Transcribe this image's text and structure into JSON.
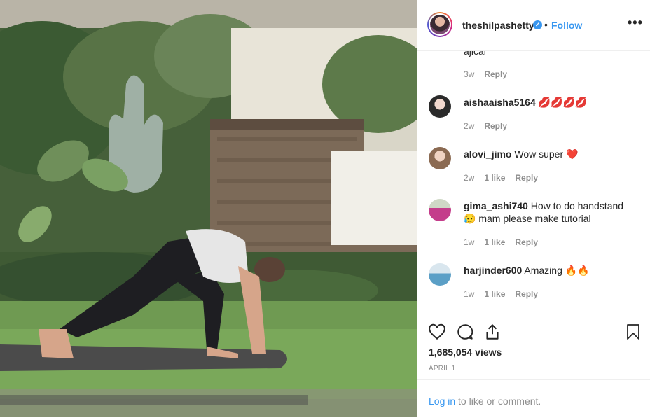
{
  "post": {
    "username": "theshilpashetty",
    "verified_mark": "✓",
    "separator": "•",
    "follow_label": "Follow",
    "more_label": "•••"
  },
  "comments": {
    "partial_text": "ajical",
    "partial_time": "3w",
    "reply_label": "Reply",
    "items": [
      {
        "user": "aishaaisha5164",
        "text": "💋💋💋💋",
        "time": "2w",
        "likes": ""
      },
      {
        "user": "alovi_jimo",
        "text": "Wow super ❤️",
        "time": "2w",
        "likes": "1 like"
      },
      {
        "user": "gima_ashi740",
        "text": "How to do handstand 😥 mam please make tutorial",
        "time": "1w",
        "likes": "1 like"
      },
      {
        "user": "harjinder600",
        "text": "Amazing 🔥🔥",
        "time": "1w",
        "likes": "1 like"
      }
    ]
  },
  "actions": {
    "icons": [
      "heart-icon",
      "comment-icon",
      "share-icon",
      "bookmark-icon"
    ],
    "views": "1,685,054 views",
    "date": "APRIL 1"
  },
  "login": {
    "link_label": "Log in",
    "suffix": " to like or comment."
  },
  "colors": {
    "accent": "#3897f0",
    "muted": "#8e8e8e",
    "text": "#262626"
  }
}
